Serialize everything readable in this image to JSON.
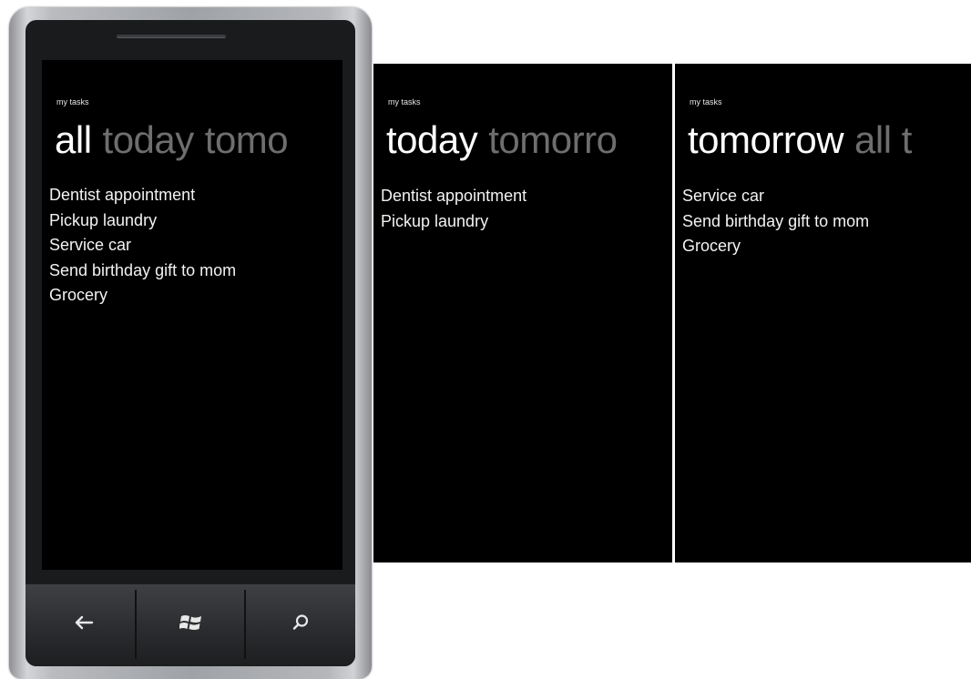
{
  "app_title": "my tasks",
  "phone": {
    "pivot": {
      "active": "all",
      "rest": [
        "today",
        "tomo"
      ]
    },
    "tasks": [
      "Dentist appointment",
      "Pickup laundry",
      "Service car",
      "Send birthday gift to mom",
      "Grocery"
    ],
    "buttons": {
      "back": "←",
      "start": "start-icon",
      "search": "search-icon"
    }
  },
  "today_panel": {
    "pivot": {
      "active": "today",
      "rest": [
        "tomorro"
      ]
    },
    "tasks": [
      "Dentist appointment",
      "Pickup laundry"
    ]
  },
  "tomorrow_panel": {
    "pivot": {
      "active": "tomorrow",
      "rest": [
        "all t"
      ]
    },
    "tasks": [
      "Service car",
      "Send birthday gift to mom",
      "Grocery"
    ]
  },
  "colors": {
    "screen": "#000000",
    "active_text": "#ffffff",
    "inactive_text": "#6e6e6e"
  }
}
